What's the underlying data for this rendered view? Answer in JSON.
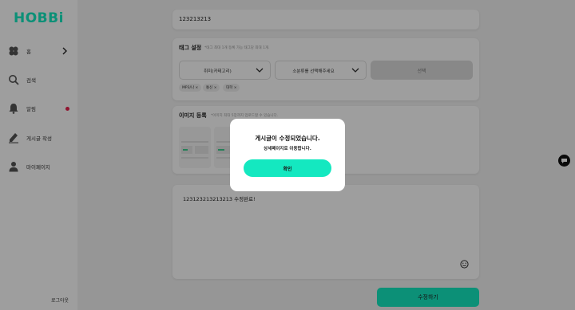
{
  "brand": {
    "logo_text": "HOBBi",
    "accent": "#14e8c0"
  },
  "sidebar": {
    "items": [
      {
        "label": "홈",
        "icon": "clover-icon"
      },
      {
        "label": "검색",
        "icon": "search-icon"
      },
      {
        "label": "알림",
        "icon": "bell-icon"
      },
      {
        "label": "게시글 작성",
        "icon": "pen-icon"
      },
      {
        "label": "마이페이지",
        "icon": "person-icon"
      }
    ],
    "logout_label": "로그아웃"
  },
  "form": {
    "title_value": "123213213",
    "tags": {
      "title": "태그 설정",
      "hint": "*태그 최대 1개 등록 가능 태그당 최대 1개.",
      "hobby_select": "취미(카테고리)",
      "region_select": "소분류를 선택해주세요",
      "apply_label": "선택",
      "chips": [
        "MP3/나 ×",
        "통신 ×",
        "대학 ×"
      ]
    },
    "image": {
      "title": "이미지 등록",
      "hint": "*이미지 최대 5장까지 업로드할 수 있습니다."
    },
    "content_value": "123123213213213 수정완료!",
    "submit_label": "수정하기"
  },
  "modal": {
    "title": "게시글이 수정되었습니다.",
    "subtitle": "상세페이지로 이동합니다.",
    "confirm_label": "확인"
  }
}
